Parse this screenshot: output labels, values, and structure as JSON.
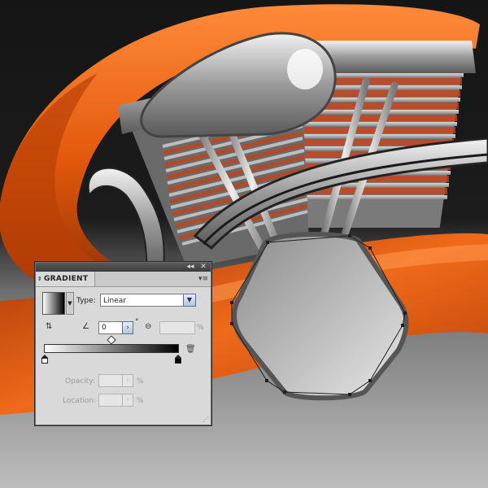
{
  "panel": {
    "title": "GRADIENT",
    "title_arrow": "⇕",
    "collapse_icon": "◂◂",
    "close_icon": "✕",
    "menu_icon": "▾≡",
    "type_label": "Type:",
    "type_value": "Linear",
    "angle_value": "0",
    "degree_symbol": "°",
    "aspect_value": "",
    "aspect_unit": "%",
    "opacity_label": "Opacity:",
    "opacity_value": "",
    "opacity_unit": "%",
    "location_label": "Location:",
    "location_value": "",
    "location_unit": "%"
  },
  "gradient": {
    "start_color": "#ffffff",
    "end_color": "#000000"
  },
  "colors": {
    "orange": "#e85a0c",
    "background_dark": "#1a1a1a",
    "background_light": "#a8a8a8",
    "chrome": "#c8c8c8"
  }
}
